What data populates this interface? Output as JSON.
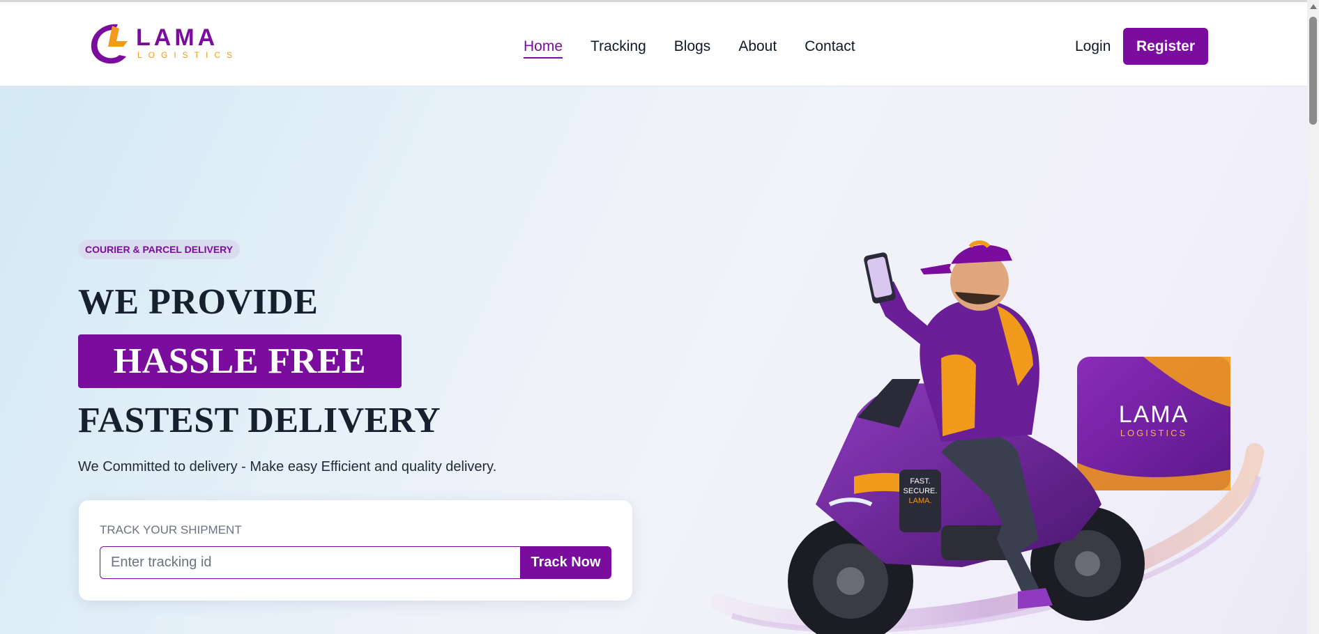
{
  "brand": {
    "name": "LAMA",
    "tagline": "LOGISTICS",
    "colors": {
      "primary": "#7a0d9e",
      "accent": "#f29a1c",
      "text": "#17202e"
    }
  },
  "nav": {
    "items": [
      {
        "label": "Home",
        "active": true
      },
      {
        "label": "Tracking",
        "active": false
      },
      {
        "label": "Blogs",
        "active": false
      },
      {
        "label": "About",
        "active": false
      },
      {
        "label": "Contact",
        "active": false
      }
    ],
    "login_label": "Login",
    "register_label": "Register"
  },
  "hero": {
    "badge": "COURIER & PARCEL DELIVERY",
    "headline_line1": "WE PROVIDE",
    "headline_highlight": "HASSLE FREE",
    "headline_line3": "FASTEST DELIVERY",
    "subtitle": "We Committed to delivery - Make easy Efficient and quality delivery.",
    "illustration": {
      "icon": "delivery-rider-illustration",
      "box_brand": "LAMA",
      "box_tagline": "LOGISTICS",
      "bike_decal": [
        "FAST.",
        "SECURE.",
        "LAMA."
      ]
    }
  },
  "track": {
    "label": "TRACK YOUR SHIPMENT",
    "placeholder": "Enter tracking id",
    "value": "",
    "button_label": "Track Now"
  }
}
